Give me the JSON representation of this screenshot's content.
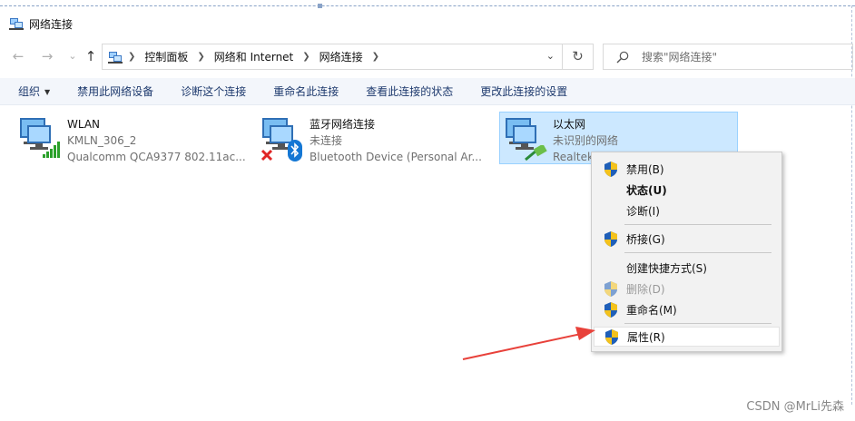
{
  "window": {
    "title": "网络连接"
  },
  "address": {
    "crumbs": [
      "控制面板",
      "网络和 Internet",
      "网络连接"
    ],
    "search_placeholder": "搜索\"网络连接\""
  },
  "toolbar": {
    "organize": "组织",
    "disable_device": "禁用此网络设备",
    "diagnose": "诊断这个连接",
    "rename": "重命名此连接",
    "view_status": "查看此连接的状态",
    "change_settings": "更改此连接的设置"
  },
  "connections": [
    {
      "name": "WLAN",
      "line2": "KMLN_306_2",
      "line3": "Qualcomm QCA9377 802.11ac..."
    },
    {
      "name": "蓝牙网络连接",
      "line2": "未连接",
      "line3": "Bluetooth Device (Personal Ar..."
    },
    {
      "name": "以太网",
      "line2": "未识别的网络",
      "line3": "Realtek PCIe GbE Family Cont..."
    }
  ],
  "context_menu": {
    "items": [
      {
        "label": "禁用(B)",
        "shield": true
      },
      {
        "label": "状态(U)",
        "shield": false,
        "bold": true
      },
      {
        "label": "诊断(I)",
        "shield": false
      },
      {
        "label": "桥接(G)",
        "shield": true
      },
      {
        "label": "创建快捷方式(S)",
        "shield": false
      },
      {
        "label": "删除(D)",
        "shield": true,
        "disabled": true
      },
      {
        "label": "重命名(M)",
        "shield": true
      },
      {
        "label": "属性(R)",
        "shield": true,
        "highlighted": true
      }
    ]
  },
  "watermark": "CSDN @MrLi先森",
  "colors": {
    "toolbar_bg": "#f3f6fb",
    "selection_bg": "#cce8ff",
    "selection_border": "#99d1ff",
    "arrow": "#e8413a"
  }
}
